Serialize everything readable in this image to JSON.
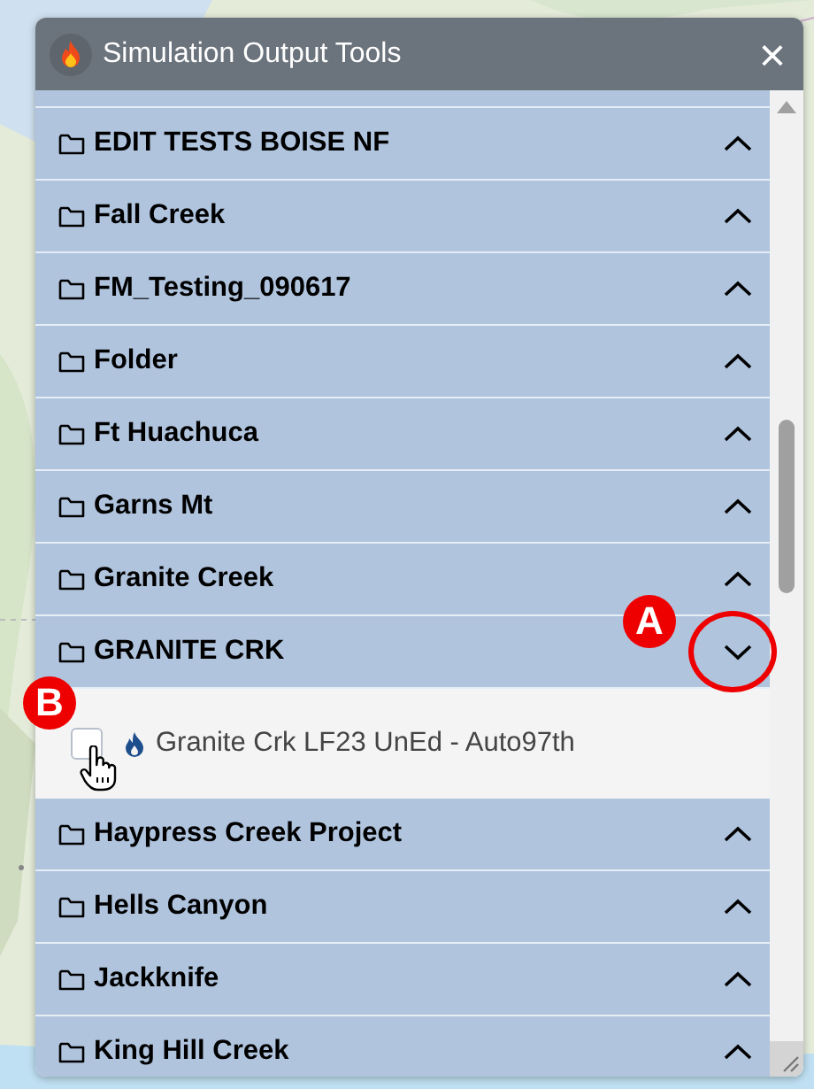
{
  "window": {
    "title": "Simulation Output Tools",
    "close": "×"
  },
  "folders": [
    {
      "name": "EDIT TESTS BOISE NF",
      "expanded": false
    },
    {
      "name": "Fall Creek",
      "expanded": false
    },
    {
      "name": "FM_Testing_090617",
      "expanded": false
    },
    {
      "name": "Folder",
      "expanded": false
    },
    {
      "name": "Ft Huachuca",
      "expanded": false
    },
    {
      "name": "Garns Mt",
      "expanded": false
    },
    {
      "name": "Granite Creek",
      "expanded": false
    },
    {
      "name": "GRANITE CRK",
      "expanded": true,
      "annotation": "A",
      "children": [
        {
          "name": "Granite Crk LF23 UnEd - Auto97th",
          "checked": false,
          "annotation": "B"
        }
      ]
    },
    {
      "name": "Haypress Creek Project",
      "expanded": false
    },
    {
      "name": "Hells Canyon",
      "expanded": false
    },
    {
      "name": "Jackknife",
      "expanded": false
    },
    {
      "name": "King Hill Creek",
      "expanded": false
    }
  ]
}
